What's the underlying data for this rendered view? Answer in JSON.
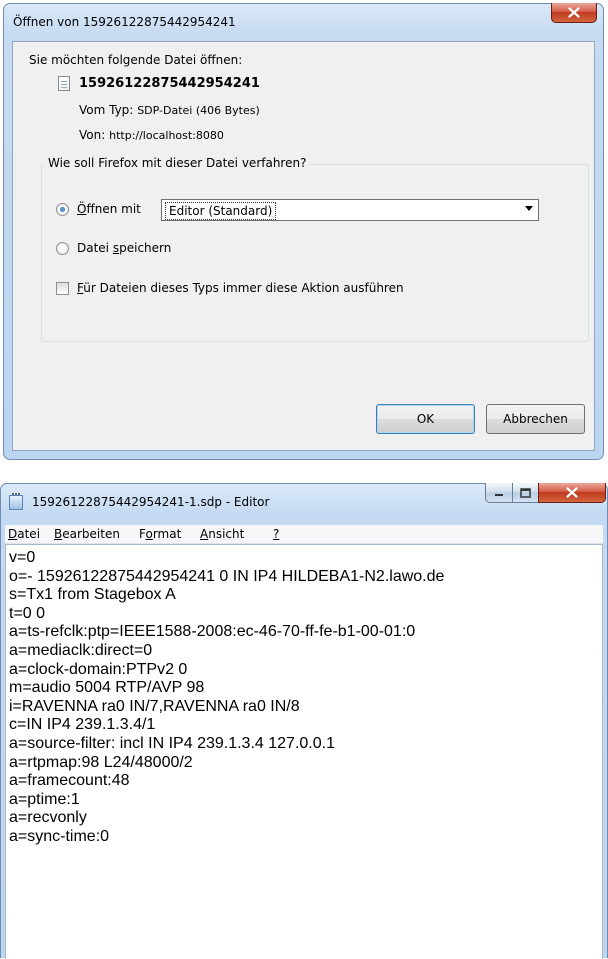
{
  "dialog": {
    "title": "Öffnen von 15926122875442954241",
    "prompt": "Sie möchten folgende Datei öffnen:",
    "filename": "15926122875442954241",
    "type_label": "Vom Typ:",
    "type_value": "SDP-Datei (406 Bytes)",
    "from_label": "Von:",
    "from_value": "http://localhost:8080",
    "group_label": "Wie soll Firefox mit dieser Datei verfahren?",
    "open_with": {
      "underline": "Ö",
      "rest": "ffnen mit",
      "selected": true
    },
    "open_with_app": "Editor (Standard)",
    "save": {
      "pre": "Datei ",
      "underline": "s",
      "rest": "peichern",
      "selected": false
    },
    "always": {
      "underline": "F",
      "rest": "ür Dateien dieses Typs immer diese Aktion ausführen",
      "checked": false
    },
    "ok_label": "OK",
    "cancel_label": "Abbrechen"
  },
  "notepad": {
    "title": "15926122875442954241-1.sdp - Editor",
    "menu": [
      {
        "underline": "D",
        "rest": "atei"
      },
      {
        "underline": "B",
        "rest": "earbeiten"
      },
      {
        "pre": "F",
        "underline": "o",
        "rest": "rmat"
      },
      {
        "underline": "A",
        "rest": "nsicht"
      },
      {
        "underline": "?",
        "rest": ""
      }
    ],
    "lines": [
      "v=0",
      "o=- 15926122875442954241 0 IN IP4 HILDEBA1-N2.lawo.de",
      "s=Tx1 from Stagebox A",
      "t=0 0",
      "a=ts-refclk:ptp=IEEE1588-2008:ec-46-70-ff-fe-b1-00-01:0",
      "a=mediaclk:direct=0",
      "a=clock-domain:PTPv2 0",
      "m=audio 5004 RTP/AVP 98",
      "i=RAVENNA ra0 IN/7,RAVENNA ra0 IN/8",
      "c=IN IP4 239.1.3.4/1",
      "a=source-filter: incl IN IP4 239.1.3.4 127.0.0.1",
      "a=rtpmap:98 L24/48000/2",
      "a=framecount:48",
      "a=ptime:1",
      "a=recvonly",
      "a=sync-time:0"
    ]
  },
  "colors": {
    "title_close": "#c0391f",
    "frame": "#bcd5f0",
    "client": "#f0f0f0"
  }
}
